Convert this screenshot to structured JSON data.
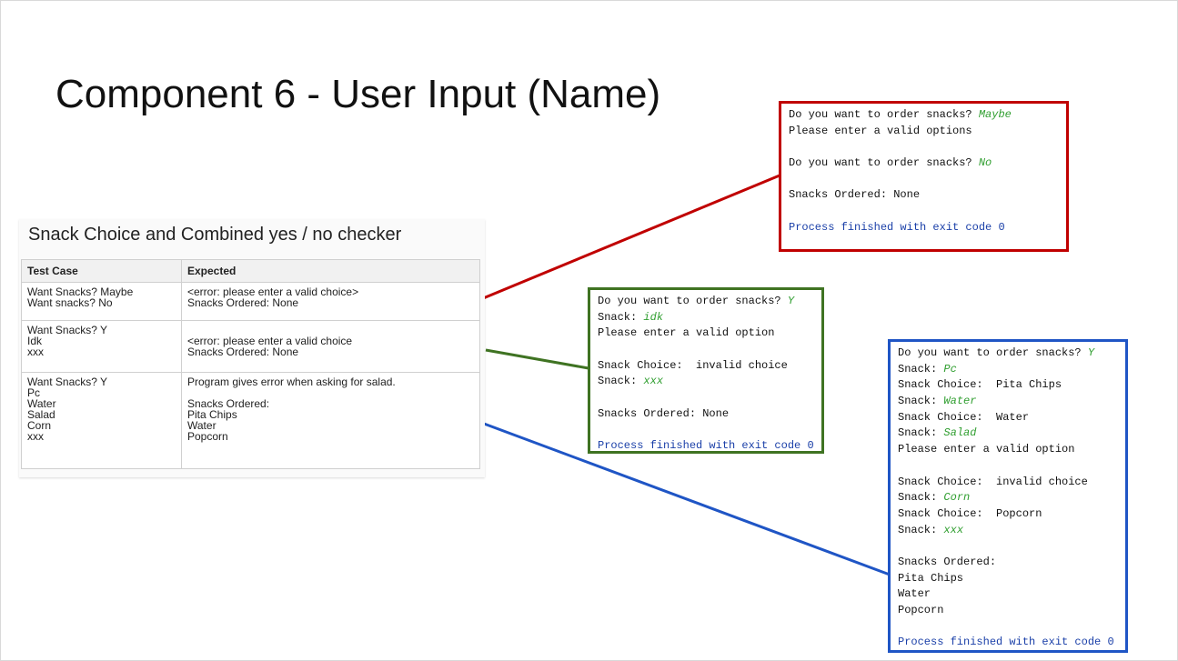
{
  "slide": {
    "title": "Component 6 - User Input (Name)"
  },
  "test_table": {
    "heading": "Snack Choice and Combined yes / no checker",
    "columns": [
      "Test Case",
      "Expected"
    ],
    "rows": [
      {
        "test_case": "Want Snacks? Maybe\nWant snacks? No",
        "expected": "<error: please enter a valid choice>\nSnacks Ordered: None"
      },
      {
        "test_case": "Want Snacks? Y\nIdk\nxxx",
        "expected": "\n<error: please enter a valid choice\nSnacks Ordered: None"
      },
      {
        "test_case": "Want Snacks? Y\nPc\nWater\nSalad\nCorn\nxxx",
        "expected": "Program gives error when asking for salad.\n\nSnacks Ordered:\nPita Chips\nWater\nPopcorn"
      }
    ]
  },
  "consoles": {
    "red": {
      "accent": "#c00000",
      "lines": [
        {
          "text": "Do you want to order snacks? ",
          "input": "Maybe"
        },
        {
          "text": "Please enter a valid options"
        },
        {
          "text": ""
        },
        {
          "text": "Do you want to order snacks? ",
          "input": "No"
        },
        {
          "text": ""
        },
        {
          "text": "Snacks Ordered: None"
        },
        {
          "text": ""
        },
        {
          "text": "Process finished with exit code 0",
          "process": true
        }
      ]
    },
    "green": {
      "accent": "#3f7322",
      "lines": [
        {
          "text": "Do you want to order snacks? ",
          "input": "Y"
        },
        {
          "text": "Snack: ",
          "input": "idk"
        },
        {
          "text": "Please enter a valid option"
        },
        {
          "text": ""
        },
        {
          "text": "Snack Choice:  invalid choice"
        },
        {
          "text": "Snack: ",
          "input": "xxx"
        },
        {
          "text": ""
        },
        {
          "text": "Snacks Ordered: None"
        },
        {
          "text": ""
        },
        {
          "text": "Process finished with exit code 0",
          "process": true
        }
      ]
    },
    "blue": {
      "accent": "#1f55c5",
      "lines": [
        {
          "text": "Do you want to order snacks? ",
          "input": "Y"
        },
        {
          "text": "Snack: ",
          "input": "Pc"
        },
        {
          "text": "Snack Choice:  Pita Chips"
        },
        {
          "text": "Snack: ",
          "input": "Water"
        },
        {
          "text": "Snack Choice:  Water"
        },
        {
          "text": "Snack: ",
          "input": "Salad"
        },
        {
          "text": "Please enter a valid option"
        },
        {
          "text": ""
        },
        {
          "text": "Snack Choice:  invalid choice"
        },
        {
          "text": "Snack: ",
          "input": "Corn"
        },
        {
          "text": "Snack Choice:  Popcorn"
        },
        {
          "text": "Snack: ",
          "input": "xxx"
        },
        {
          "text": ""
        },
        {
          "text": "Snacks Ordered:"
        },
        {
          "text": "Pita Chips"
        },
        {
          "text": "Water"
        },
        {
          "text": "Popcorn"
        },
        {
          "text": ""
        },
        {
          "text": "Process finished with exit code 0",
          "process": true
        }
      ]
    }
  },
  "colors": {
    "user_input": "#2f9e2f",
    "process_text": "#1a3fa8"
  }
}
